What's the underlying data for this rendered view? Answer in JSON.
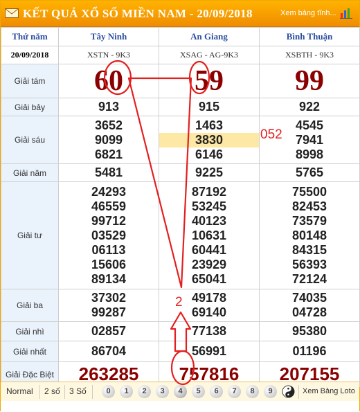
{
  "header": {
    "title": "KẾT QUẢ XỔ SỐ MIỀN NAM - 20/09/2018",
    "view_table": "Xem bảng tĩnh...",
    "mail_icon": "mail-icon",
    "chart_icon": "bar-chart-icon"
  },
  "table": {
    "corner_label": "Thứ năm",
    "date": "20/09/2018",
    "provinces": [
      "Tây Ninh",
      "An Giang",
      "Bình Thuận"
    ],
    "codes": [
      "XSTN - 9K3",
      "XSAG - AG-9K3",
      "XSBTH - 9K3"
    ],
    "prizes": [
      {
        "label": "Giải tám",
        "values": [
          [
            "60"
          ],
          [
            "59"
          ],
          [
            "99"
          ]
        ]
      },
      {
        "label": "Giải bảy",
        "values": [
          [
            "913"
          ],
          [
            "915"
          ],
          [
            "922"
          ]
        ]
      },
      {
        "label": "Giải sáu",
        "values": [
          [
            "3652",
            "9099",
            "6821"
          ],
          [
            "1463",
            "3830",
            "6146"
          ],
          [
            "4545",
            "7941",
            "8998"
          ]
        ]
      },
      {
        "label": "Giải năm",
        "values": [
          [
            "5481"
          ],
          [
            "9225"
          ],
          [
            "5765"
          ]
        ]
      },
      {
        "label": "Giải tư",
        "values": [
          [
            "24293",
            "46559",
            "99712",
            "03529",
            "06113",
            "15606",
            "89134"
          ],
          [
            "87192",
            "53245",
            "40123",
            "10631",
            "60441",
            "23929",
            "65041"
          ],
          [
            "75500",
            "82453",
            "73579",
            "80148",
            "84315",
            "56393",
            "72124"
          ]
        ]
      },
      {
        "label": "Giải ba",
        "values": [
          [
            "37302",
            "99287"
          ],
          [
            "49178",
            "69140"
          ],
          [
            "74035",
            "04728"
          ]
        ]
      },
      {
        "label": "Giải nhì",
        "values": [
          [
            "02857"
          ],
          [
            "77138"
          ],
          [
            "95380"
          ]
        ]
      },
      {
        "label": "Giải nhất",
        "values": [
          [
            "86704"
          ],
          [
            "56991"
          ],
          [
            "01196"
          ]
        ]
      },
      {
        "label": "Giải Đặc Biệt",
        "values": [
          [
            "263285"
          ],
          [
            "757816"
          ],
          [
            "207155"
          ]
        ]
      }
    ]
  },
  "bottom_bar": {
    "options": [
      "Normal",
      "2 số",
      "3 Số"
    ],
    "digits": [
      "0",
      "1",
      "2",
      "3",
      "4",
      "5",
      "6",
      "7",
      "8",
      "9"
    ],
    "selected_digit": "4",
    "yin_yang_icon": "yin-yang-icon",
    "view_loto": "Xem Bảng Loto"
  },
  "annotations": {
    "note_1": "052",
    "note_2": "2",
    "color": "#e32020"
  }
}
